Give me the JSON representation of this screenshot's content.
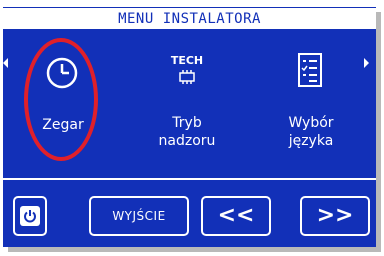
{
  "title": "MENU INSTALATORA",
  "menu": {
    "items": [
      {
        "label_lines": [
          "Zegar"
        ],
        "icon": "clock-icon",
        "highlighted": true
      },
      {
        "label_lines": [
          "Tryb",
          "nadzoru"
        ],
        "icon": "chip-icon",
        "icon_text": "TECH"
      },
      {
        "label_lines": [
          "Wybór",
          "języka"
        ],
        "icon": "checklist-icon"
      }
    ]
  },
  "footer": {
    "power_icon": "power-icon",
    "exit_label": "WYJŚCIE",
    "prev_label": "<<",
    "next_label": ">>"
  },
  "colors": {
    "lcd_blue": "#1230b8",
    "highlight_red": "#e0202a",
    "text_white": "#ffffff"
  }
}
